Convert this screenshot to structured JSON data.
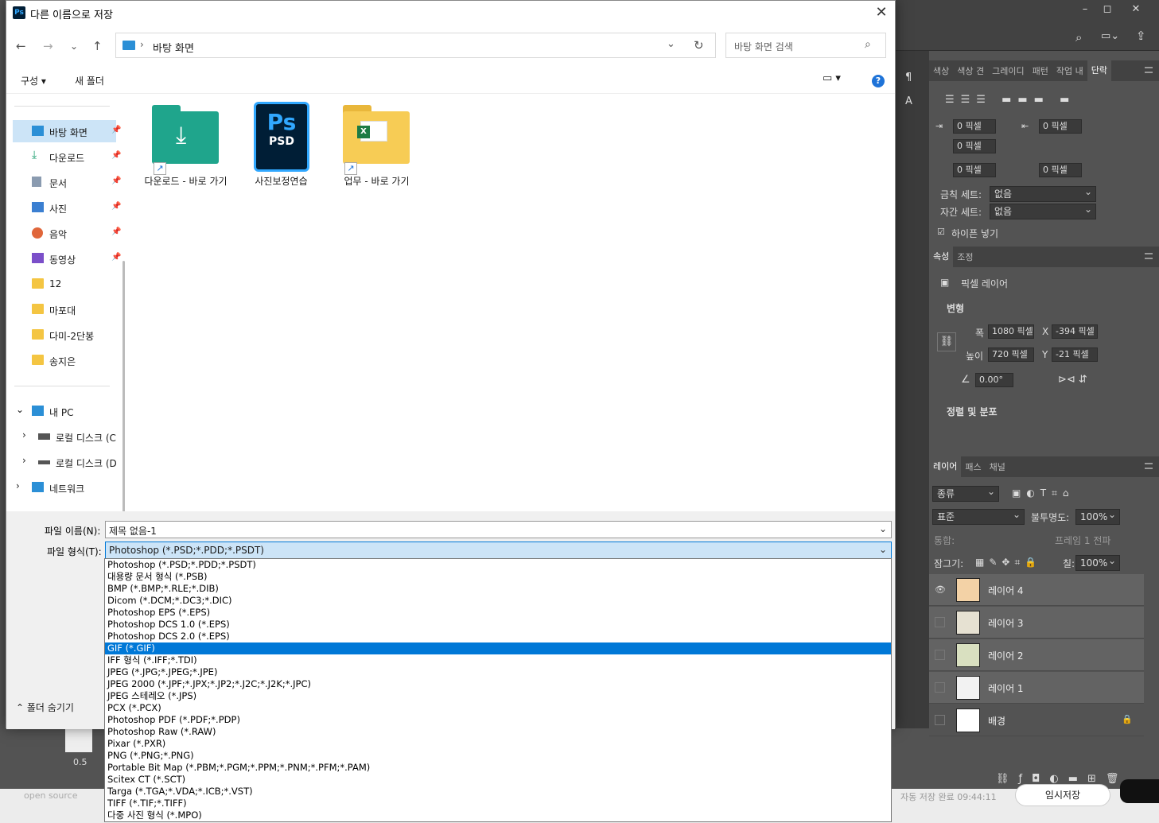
{
  "dialog": {
    "title": "다른 이름으로 저장",
    "logo": "Ps",
    "address_path": "바탕 화면",
    "search_placeholder": "바탕 화면 검색",
    "organize": "구성 ▾",
    "new_folder": "새 폴더",
    "help": "?"
  },
  "sidebar": {
    "quick": [
      {
        "label": "바탕 화면",
        "icon": "desktop-icon",
        "pinned": true,
        "selected": true
      },
      {
        "label": "다운로드",
        "icon": "download-icon",
        "pinned": true
      },
      {
        "label": "문서",
        "icon": "document-icon",
        "pinned": true
      },
      {
        "label": "사진",
        "icon": "picture-icon",
        "pinned": true
      },
      {
        "label": "음악",
        "icon": "music-icon",
        "pinned": true
      },
      {
        "label": "동영상",
        "icon": "video-icon",
        "pinned": true
      },
      {
        "label": "12",
        "icon": "folder-icon"
      },
      {
        "label": "마포대",
        "icon": "folder-icon"
      },
      {
        "label": "다미-2단봉",
        "icon": "folder-icon"
      },
      {
        "label": "송지은",
        "icon": "folder-icon"
      }
    ],
    "this_pc": "내 PC",
    "drive_c": "로컬 디스크 (C",
    "drive_d": "로컬 디스크 (D",
    "network": "네트워크"
  },
  "files": [
    {
      "label": "다운로드 - 바로 가기",
      "icon": "download-folder-shortcut-icon"
    },
    {
      "label": "사진보정연습",
      "icon": "psd-file-icon"
    },
    {
      "label": "업무 - 바로 가기",
      "icon": "excel-folder-shortcut-icon"
    }
  ],
  "psd_badge": {
    "ps": "Ps",
    "psd": "PSD"
  },
  "form": {
    "filename_label": "파일 이름(N):",
    "filename_value": "제목 없음-1",
    "filetype_label": "파일 형식(T):",
    "filetype_value": "Photoshop (*.PSD;*.PDD;*.PSDT)",
    "hide_folders": "폴더 숨기기"
  },
  "filetype_options": [
    "Photoshop (*.PSD;*.PDD;*.PSDT)",
    "대용량 문서 형식 (*.PSB)",
    "BMP (*.BMP;*.RLE;*.DIB)",
    "Dicom (*.DCM;*.DC3;*.DIC)",
    "Photoshop EPS (*.EPS)",
    "Photoshop DCS 1.0 (*.EPS)",
    "Photoshop DCS 2.0 (*.EPS)",
    "GIF (*.GIF)",
    "IFF 형식 (*.IFF;*.TDI)",
    "JPEG (*.JPG;*.JPEG;*.JPE)",
    "JPEG 2000 (*.JPF;*.JPX;*.JP2;*.J2C;*.J2K;*.JPC)",
    "JPEG 스테레오 (*.JPS)",
    "PCX (*.PCX)",
    "Photoshop PDF (*.PDF;*.PDP)",
    "Photoshop Raw (*.RAW)",
    "Pixar (*.PXR)",
    "PNG (*.PNG;*.PNG)",
    "Portable Bit Map (*.PBM;*.PGM;*.PPM;*.PNM;*.PFM;*.PAM)",
    "Scitex CT (*.SCT)",
    "Targa (*.TGA;*.VDA;*.ICB;*.VST)",
    "TIFF (*.TIF;*.TIFF)",
    "다중 사진 형식 (*.MPO)"
  ],
  "highlighted_option": "GIF (*.GIF)",
  "photoshop": {
    "panel_tabs": [
      "색상",
      "색상 견",
      "그레이디",
      "패턴",
      "작업 내",
      "단락"
    ],
    "active_tab": "단락",
    "spacing": [
      "0 픽셀",
      "0 픽셀",
      "0 픽셀",
      "0 픽셀",
      "0 픽셀"
    ],
    "kinsoku_label": "금칙 세트:",
    "kinsoku_value": "없음",
    "mojikumi_label": "자간 세트:",
    "mojikumi_value": "없음",
    "hyphen_label": "하이픈 넣기",
    "props_tabs": [
      "속성",
      "조정"
    ],
    "pixel_layer": "픽셀 레이어",
    "transform": "변형",
    "width_label": "폭",
    "width_value": "1080 픽셀",
    "height_label": "높이",
    "height_value": "720 픽셀",
    "x_label": "X",
    "x_value": "-394 픽셀",
    "y_label": "Y",
    "y_value": "-21 픽셀",
    "angle": "0.00°",
    "align": "정렬 및 분포",
    "layer_tabs": [
      "레이어",
      "패스",
      "채널"
    ],
    "kind": "종류",
    "blend": "표준",
    "opacity_label": "불투명도:",
    "opacity_value": "100%",
    "unify": "통합:",
    "frame": "프레임 1 전파",
    "lock_label": "잠그기:",
    "fill_label": "칠:",
    "fill_value": "100%",
    "layers": [
      "레이어 4",
      "레이어 3",
      "레이어 2",
      "레이어 1",
      "배경"
    ],
    "zoom": "0.5",
    "status_left": "open source",
    "status_mid": "자동 저장 완료 09:44:11",
    "status_btn": "임시저장"
  }
}
